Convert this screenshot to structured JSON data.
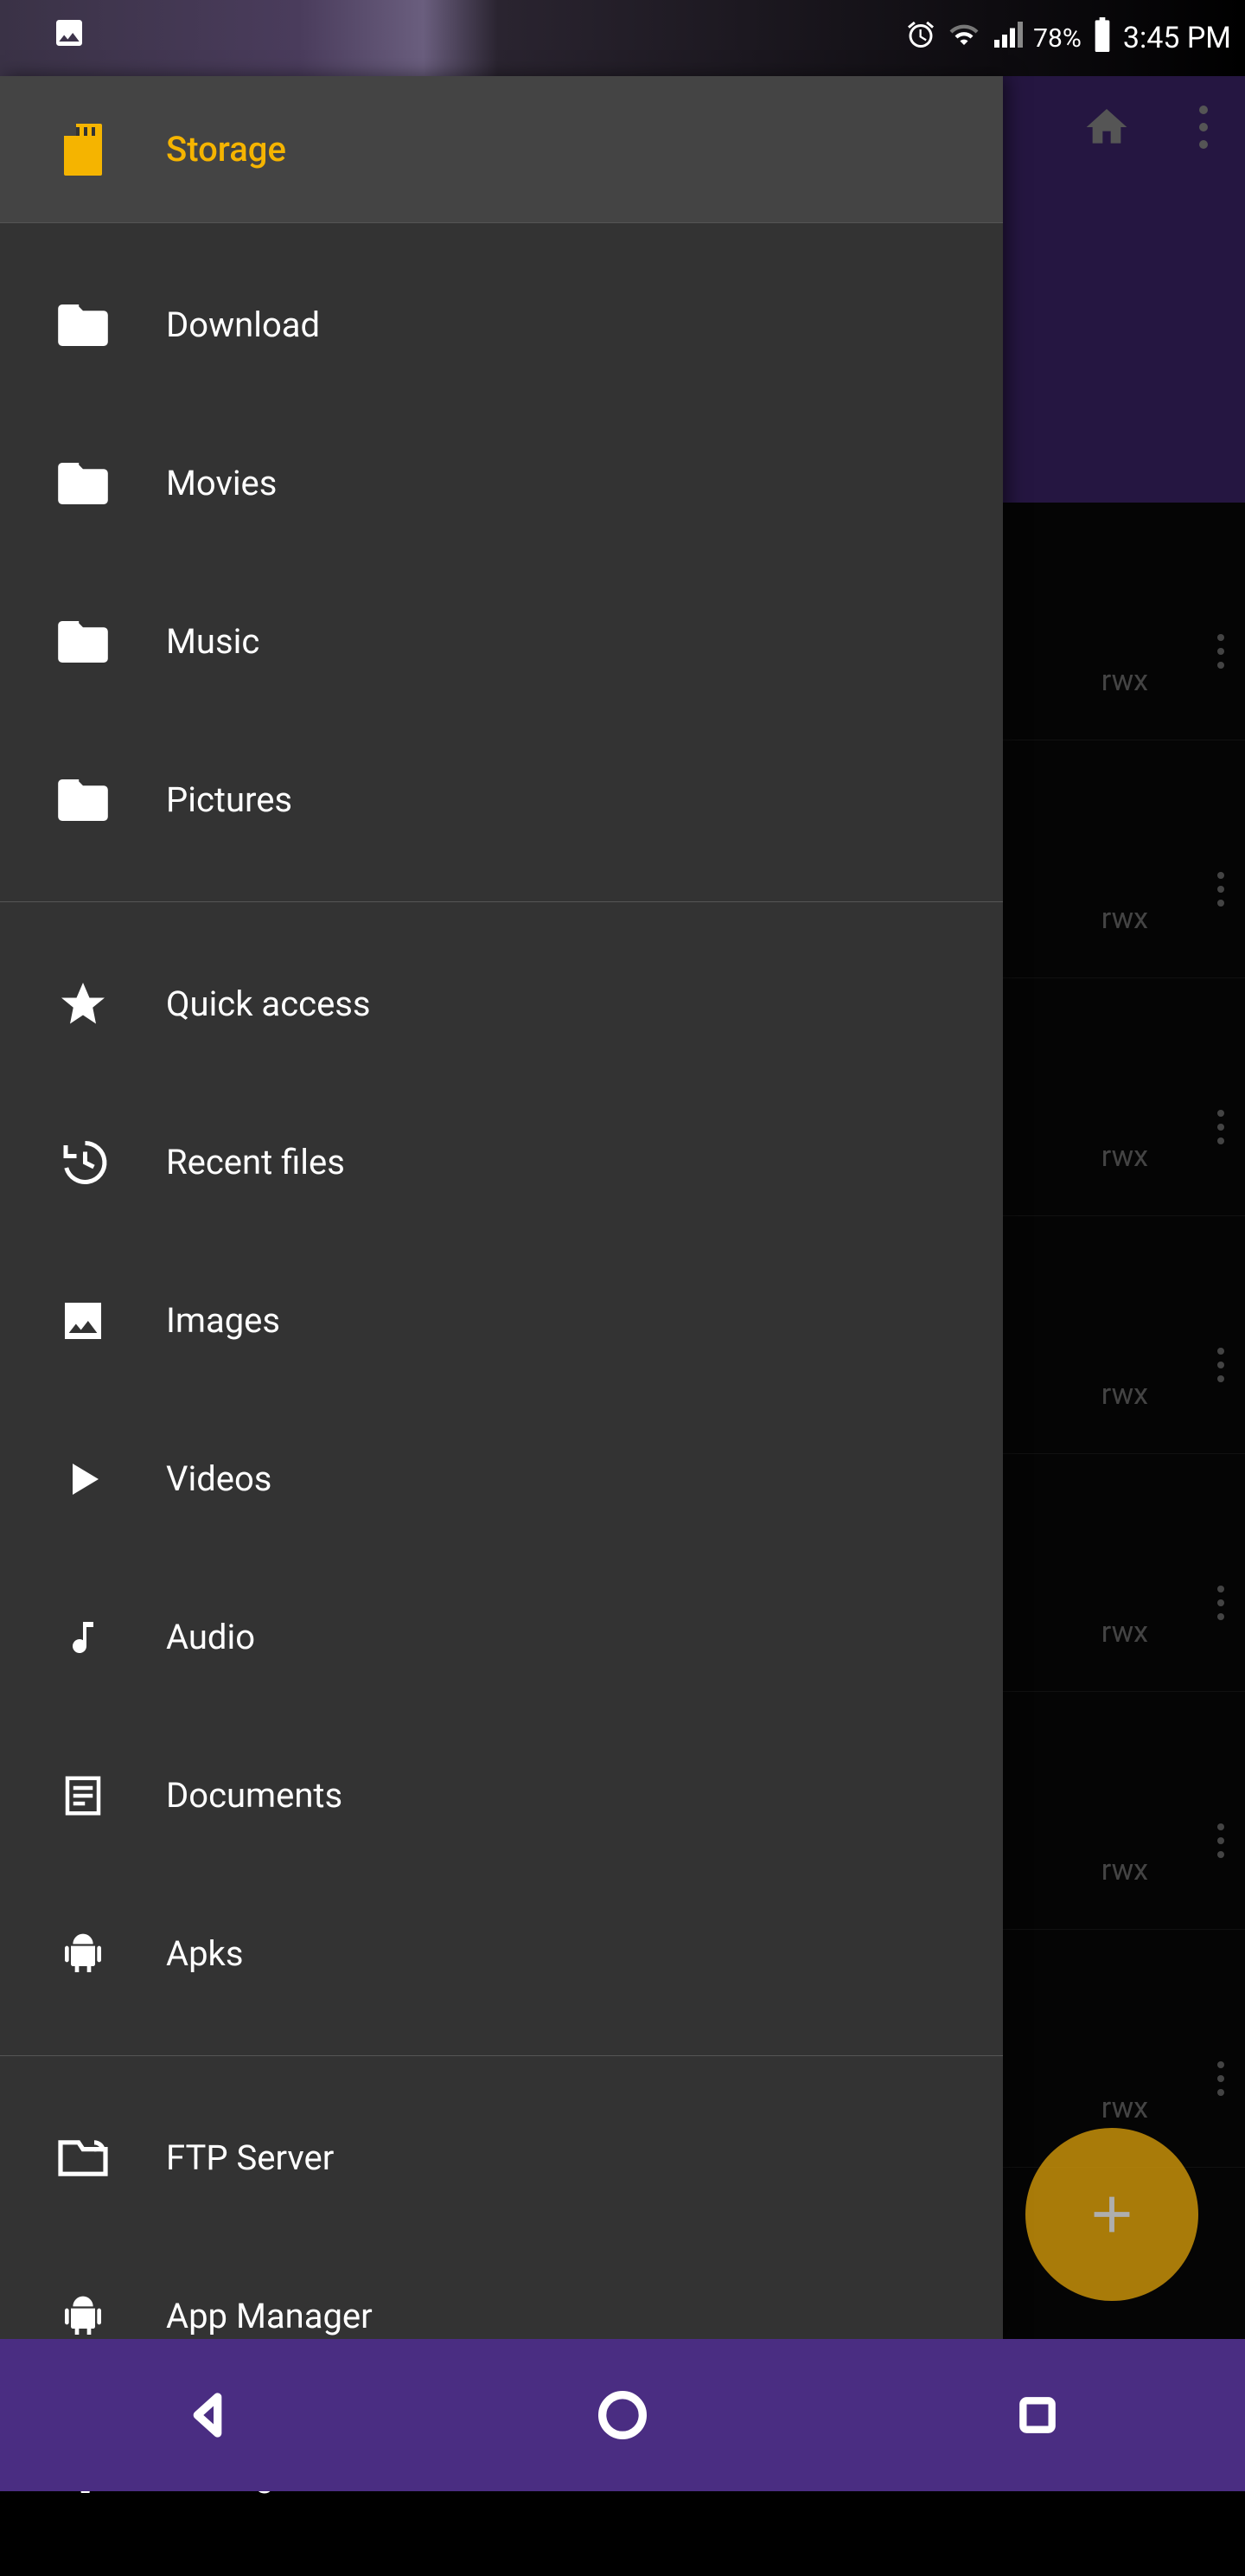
{
  "status": {
    "battery_pct": "78%",
    "time": "3:45 PM"
  },
  "drawer": {
    "header_label": "Storage",
    "folders": [
      {
        "icon": "folder",
        "label": "Download"
      },
      {
        "icon": "folder",
        "label": "Movies"
      },
      {
        "icon": "folder",
        "label": "Music"
      },
      {
        "icon": "folder",
        "label": "Pictures"
      }
    ],
    "library": [
      {
        "icon": "star",
        "label": "Quick access"
      },
      {
        "icon": "history",
        "label": "Recent files"
      },
      {
        "icon": "image",
        "label": "Images"
      },
      {
        "icon": "play",
        "label": "Videos"
      },
      {
        "icon": "audio",
        "label": "Audio"
      },
      {
        "icon": "doc",
        "label": "Documents"
      },
      {
        "icon": "android",
        "label": "Apks"
      }
    ],
    "tools": [
      {
        "icon": "ftp",
        "label": "FTP Server"
      },
      {
        "icon": "android",
        "label": "App Manager"
      },
      {
        "icon": "gear",
        "label": "Settings"
      }
    ]
  },
  "background_rows": {
    "perm": "rwx",
    "count": 7
  }
}
